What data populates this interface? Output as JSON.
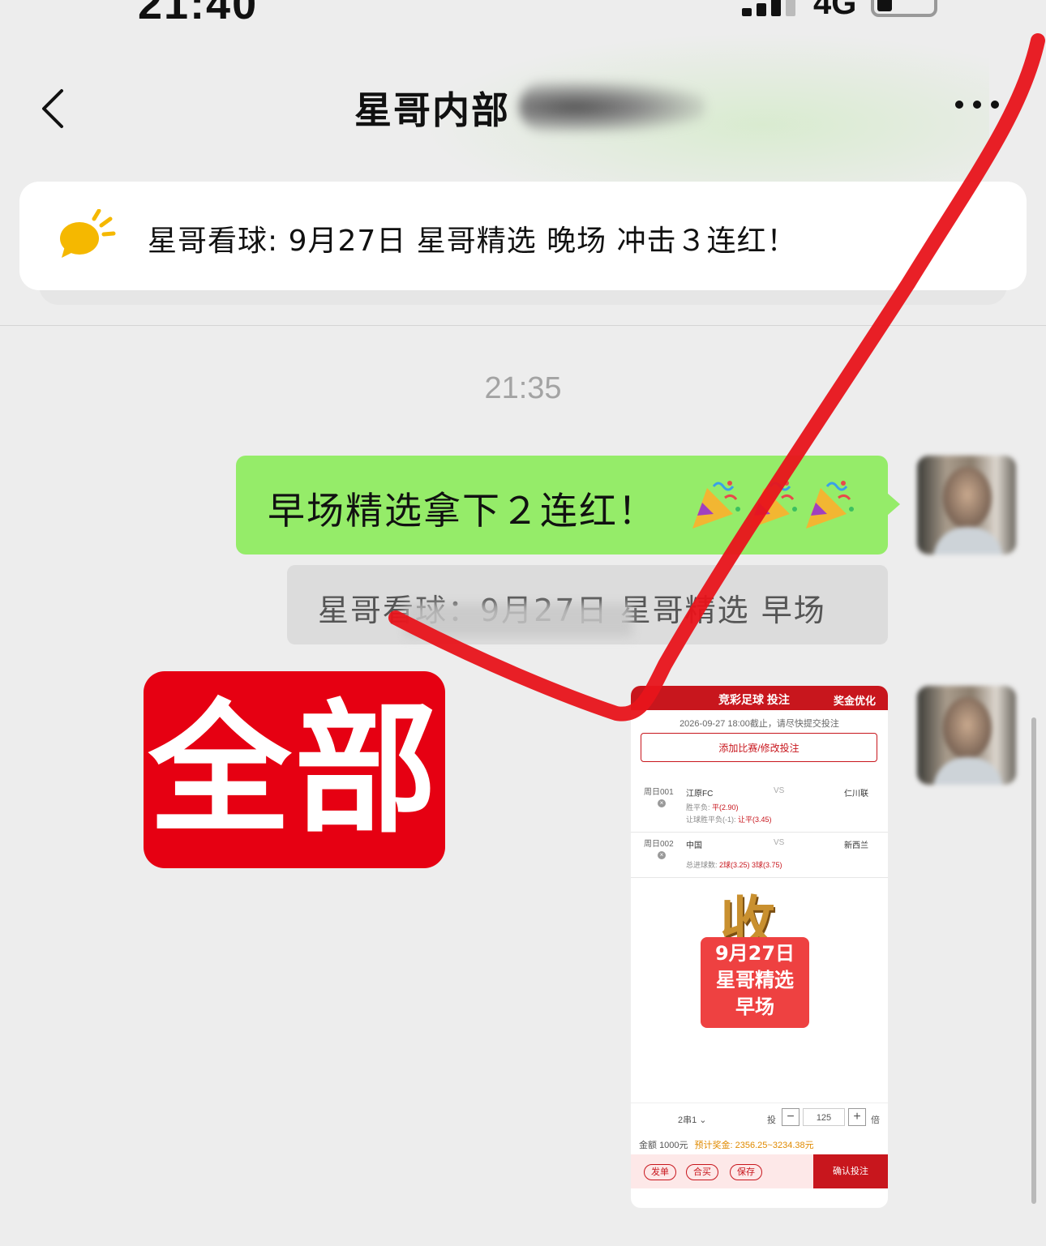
{
  "status_bar": {
    "time": "21:40",
    "network": "4G"
  },
  "nav": {
    "title": "星哥内部"
  },
  "announcement": {
    "text": "星哥看球: 9月27日 星哥精选 晚场 冲击３连红！"
  },
  "messages": {
    "timestamp": "21:35",
    "m1": {
      "text": "早场精选拿下２连红！",
      "quote": "星哥看球：9月27日 星哥精选 早场"
    },
    "sticker": {
      "text": "全部"
    }
  },
  "bet_slip": {
    "title": "竞彩足球 投注",
    "optimize": "奖金优化",
    "deadline": "2026-09-27 18:00截止，请尽快提交投注",
    "add_button": "添加比赛/修改投注",
    "matches": [
      {
        "id": "周日001",
        "home": "江原FC",
        "vs": "VS",
        "away": "仁川联",
        "line1": "胜平负: ",
        "line1_pick": "平(2.90)",
        "line2": "让球胜平负(-1): ",
        "line2_pick": "让平(3.45)"
      },
      {
        "id": "周日002",
        "home": "中国",
        "vs": "VS",
        "away": "新西兰",
        "line1": "总进球数: ",
        "line1_pick": "2球(3.25) 3球(3.75)"
      }
    ],
    "stamp": "收",
    "card_lines": [
      "9月27日",
      "星哥精选",
      "早场"
    ],
    "chuan": "2串1",
    "tou": "投",
    "qty": "125",
    "bei": "倍",
    "amount_label": "金额",
    "amount": "1000元",
    "prize": "预计奖金: 2356.25~3234.38元",
    "actions": [
      "发单",
      "合买",
      "保存"
    ],
    "confirm": "确认投注"
  }
}
